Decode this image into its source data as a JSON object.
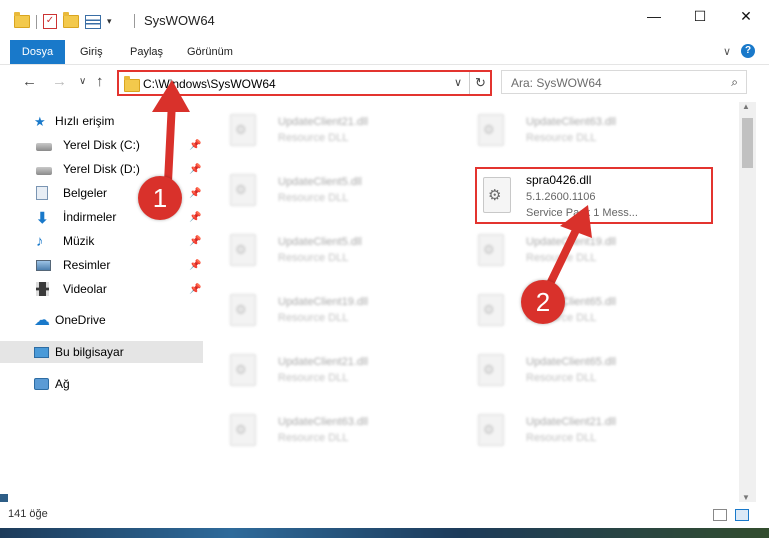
{
  "window": {
    "title": "SysWOW64",
    "min_glyph": "—",
    "max_glyph": "☐",
    "close_glyph": "✕"
  },
  "ribbon": {
    "tabs": [
      "Dosya",
      "Giriş",
      "Paylaş",
      "Görünüm"
    ],
    "expand_glyph": "∨",
    "help_glyph": "?"
  },
  "nav": {
    "back_glyph": "←",
    "forward_glyph": "→",
    "recent_glyph": "∨",
    "up_glyph": "↑",
    "address": "C:\\Windows\\SysWOW64",
    "address_drop_glyph": "∨",
    "refresh_glyph": "↻",
    "search_placeholder": "Ara: SysWOW64",
    "search_glyph": "⌕"
  },
  "sidebar": {
    "pin_glyph": "📌",
    "quick_access": "Hızlı erişim",
    "items": [
      {
        "label": "Yerel Disk (C:)",
        "icon": "drive-icon"
      },
      {
        "label": "Yerel Disk (D:)",
        "icon": "drive-icon"
      },
      {
        "label": "Belgeler",
        "icon": "documents-icon"
      },
      {
        "label": "İndirmeler",
        "icon": "downloads-icon"
      },
      {
        "label": "Müzik",
        "icon": "music-icon"
      },
      {
        "label": "Resimler",
        "icon": "pictures-icon"
      },
      {
        "label": "Videolar",
        "icon": "videos-icon"
      }
    ],
    "onedrive": "OneDrive",
    "this_pc": "Bu bilgisayar",
    "network": "Ağ"
  },
  "files": {
    "left_column": [
      {
        "name": "UpdateClient21.dll",
        "type": "Resource DLL"
      },
      {
        "name": "UpdateClient5.dll",
        "type": "Resource DLL"
      },
      {
        "name": "UpdateClient5.dll",
        "type": "Resource DLL"
      },
      {
        "name": "UpdateClient19.dll",
        "type": "Resource DLL"
      },
      {
        "name": "UpdateClient21.dll",
        "type": "Resource DLL"
      },
      {
        "name": "UpdateClient63.dll",
        "type": "Resource DLL"
      }
    ],
    "right_column": [
      {
        "name": "UpdateClient63.dll",
        "type": "Resource DLL"
      },
      {
        "name": "UpdateClient19.dll",
        "type": "Resource DLL"
      },
      {
        "name": "UpdateClient65.dll",
        "type": "Resource DLL"
      },
      {
        "name": "UpdateClient65.dll",
        "type": "Resource DLL"
      },
      {
        "name": "UpdateClient21.dll",
        "type": "Resource DLL"
      }
    ],
    "highlighted": {
      "name": "spra0426.dll",
      "version": "5.1.2600.1106",
      "description": "Service Pack 1 Mess..."
    }
  },
  "annotations": {
    "step1": "1",
    "step2": "2",
    "color": "#d9312b"
  },
  "scrollbar": {
    "up_glyph": "▲",
    "down_glyph": "▼"
  },
  "status": {
    "item_count": "141 öğe"
  }
}
